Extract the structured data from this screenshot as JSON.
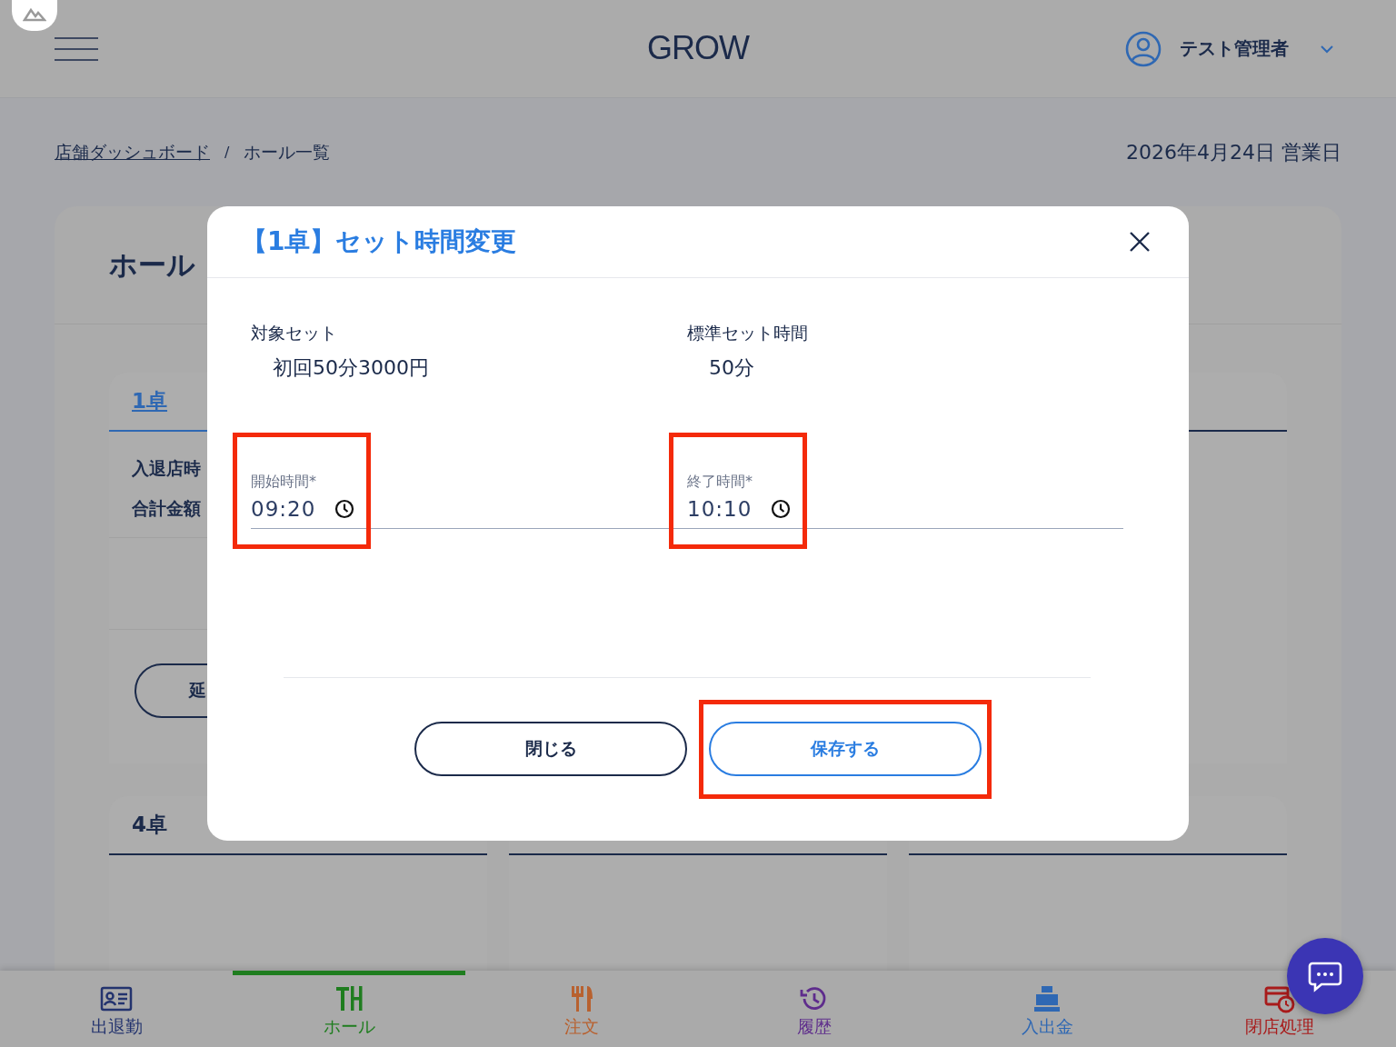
{
  "header": {
    "title": "GROW",
    "user": "テスト管理者"
  },
  "breadcrumb": {
    "items": [
      {
        "label": "店舗ダッシュボード",
        "link": true
      },
      {
        "label": "ホール一覧",
        "link": false
      }
    ],
    "separator": "/"
  },
  "business_date": "2026年4月24日 営業日",
  "hall": {
    "heading": "ホール",
    "tables": [
      {
        "name": "1卓",
        "selected": true,
        "rows": [
          "入退店時",
          "合計金額"
        ],
        "button": "延"
      },
      {
        "name": "4卓",
        "selected": false
      }
    ]
  },
  "modal": {
    "title": "【1卓】セット時間変更",
    "info": [
      {
        "label": "対象セット",
        "value": "初回50分3000円"
      },
      {
        "label": "標準セット時間",
        "value": "50分"
      }
    ],
    "fields": [
      {
        "label": "開始時間*",
        "value": "09:20",
        "highlighted": true
      },
      {
        "label": "終了時間*",
        "value": "10:10",
        "highlighted": true
      }
    ],
    "buttons": [
      {
        "label": "閉じる",
        "kind": "secondary",
        "highlighted": false
      },
      {
        "label": "保存する",
        "kind": "primary",
        "highlighted": true
      }
    ]
  },
  "bottom_nav": [
    {
      "label": "出退勤",
      "color": "#23336e",
      "selected": false
    },
    {
      "label": "ホール",
      "color": "#1f7d1f",
      "selected": true
    },
    {
      "label": "注文",
      "color": "#b8612f",
      "selected": false
    },
    {
      "label": "履歴",
      "color": "#5e2c8c",
      "selected": false
    },
    {
      "label": "入出金",
      "color": "#2f68b3",
      "selected": false
    },
    {
      "label": "閉店処理",
      "color": "#a81b1b",
      "selected": false
    }
  ]
}
